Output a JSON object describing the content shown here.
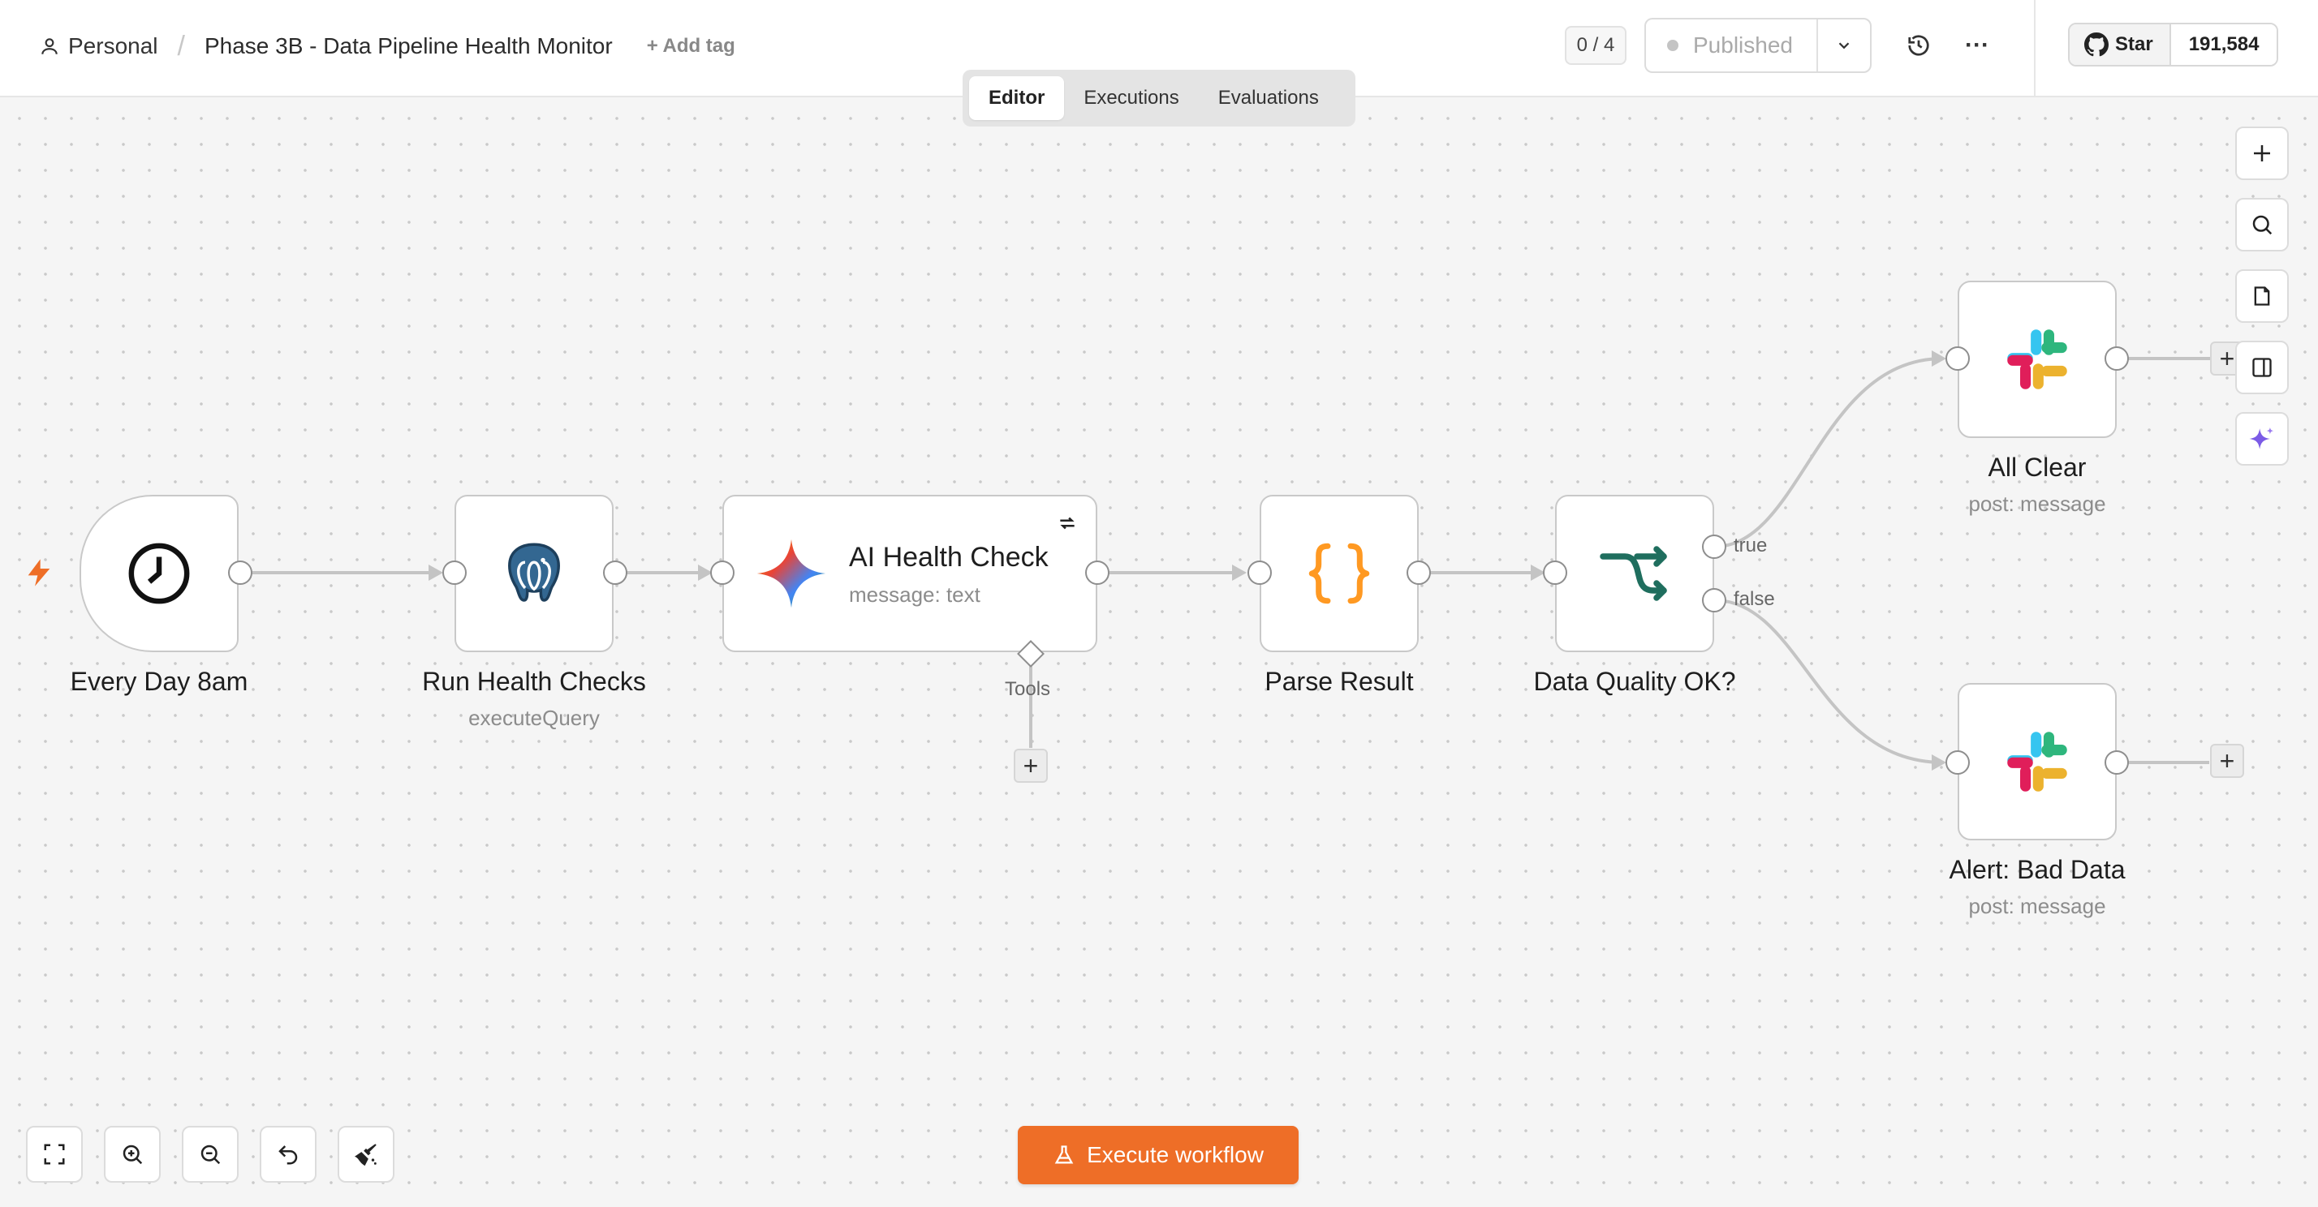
{
  "header": {
    "breadcrumb_personal": "Personal",
    "breadcrumb_separator": "/",
    "workflow_title": "Phase 3B - Data Pipeline Health Monitor",
    "add_tag_label": "+ Add tag",
    "counter": "0 / 4",
    "publish_label": "Published",
    "github_star_label": "Star",
    "github_star_count": "191,584"
  },
  "tabs": [
    {
      "label": "Editor",
      "active": true
    },
    {
      "label": "Executions",
      "active": false
    },
    {
      "label": "Evaluations",
      "active": false
    }
  ],
  "nodes": {
    "every_day": {
      "label": "Every Day 8am",
      "icon": "clock-icon"
    },
    "run_health": {
      "label": "Run Health Checks",
      "sub": "executeQuery",
      "icon": "postgres-elephant-icon"
    },
    "ai_health": {
      "label": "AI Health Check",
      "sub": "message: text",
      "tools_label": "Tools",
      "icon": "gemini-icon"
    },
    "parse_result": {
      "label": "Parse Result",
      "icon": "code-braces-icon"
    },
    "data_quality": {
      "label": "Data Quality OK?",
      "true_label": "true",
      "false_label": "false",
      "icon": "if-branch-icon"
    },
    "all_clear": {
      "label": "All Clear",
      "sub": "post: message",
      "icon": "slack-icon"
    },
    "alert_bad": {
      "label": "Alert: Bad Data",
      "sub": "post: message",
      "icon": "slack-icon"
    }
  },
  "execute_button": {
    "label": "Execute workflow"
  },
  "colors": {
    "accent": "#ee6e27",
    "if_green": "#1f6e5e",
    "code_orange": "#ff9922",
    "postgres_blue": "#336791"
  }
}
